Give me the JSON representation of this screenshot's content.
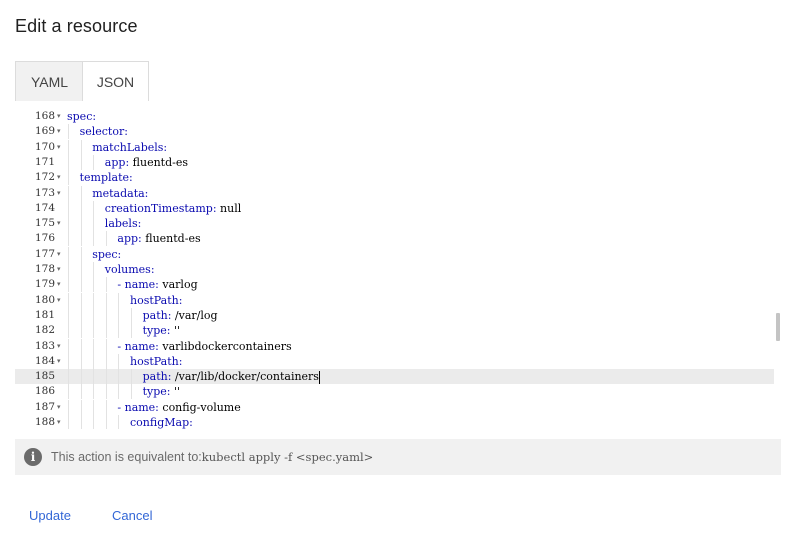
{
  "dialog": {
    "title": "Edit a resource"
  },
  "tabs": [
    {
      "label": "YAML",
      "active": false
    },
    {
      "label": "JSON",
      "active": true
    }
  ],
  "editor": {
    "active_line": "185",
    "lines": [
      {
        "num": "168",
        "fold": true,
        "indent": 0,
        "key": "spec:",
        "value": ""
      },
      {
        "num": "169",
        "fold": true,
        "indent": 1,
        "key": "selector:",
        "value": ""
      },
      {
        "num": "170",
        "fold": true,
        "indent": 2,
        "key": "matchLabels:",
        "value": ""
      },
      {
        "num": "171",
        "fold": false,
        "indent": 3,
        "key": "app:",
        "value": " fluentd-es"
      },
      {
        "num": "172",
        "fold": true,
        "indent": 1,
        "key": "template:",
        "value": ""
      },
      {
        "num": "173",
        "fold": true,
        "indent": 2,
        "key": "metadata:",
        "value": ""
      },
      {
        "num": "174",
        "fold": false,
        "indent": 3,
        "key": "creationTimestamp:",
        "value": " null"
      },
      {
        "num": "175",
        "fold": true,
        "indent": 3,
        "key": "labels:",
        "value": ""
      },
      {
        "num": "176",
        "fold": false,
        "indent": 4,
        "key": "app:",
        "value": " fluentd-es"
      },
      {
        "num": "177",
        "fold": true,
        "indent": 2,
        "key": "spec:",
        "value": ""
      },
      {
        "num": "178",
        "fold": true,
        "indent": 3,
        "key": "volumes:",
        "value": ""
      },
      {
        "num": "179",
        "fold": true,
        "indent": 4,
        "key": "- name:",
        "value": " varlog"
      },
      {
        "num": "180",
        "fold": true,
        "indent": 5,
        "key": "hostPath:",
        "value": ""
      },
      {
        "num": "181",
        "fold": false,
        "indent": 6,
        "key": "path:",
        "value": " /var/log"
      },
      {
        "num": "182",
        "fold": false,
        "indent": 6,
        "key": "type:",
        "value": " ''"
      },
      {
        "num": "183",
        "fold": true,
        "indent": 4,
        "key": "- name:",
        "value": " varlibdockercontainers"
      },
      {
        "num": "184",
        "fold": true,
        "indent": 5,
        "key": "hostPath:",
        "value": ""
      },
      {
        "num": "185",
        "fold": false,
        "indent": 6,
        "key": "path:",
        "value": " /var/lib/docker/containers"
      },
      {
        "num": "186",
        "fold": false,
        "indent": 6,
        "key": "type:",
        "value": " ''"
      },
      {
        "num": "187",
        "fold": true,
        "indent": 4,
        "key": "- name:",
        "value": " config-volume"
      },
      {
        "num": "188",
        "fold": true,
        "indent": 5,
        "key": "configMap:",
        "value": ""
      }
    ]
  },
  "info": {
    "icon": "info-icon",
    "glyph": "i",
    "text": "This action is equivalent to:",
    "command": "kubectl apply -f <spec.yaml>"
  },
  "actions": {
    "update_label": "Update",
    "cancel_label": "Cancel"
  },
  "colors": {
    "accent": "#3367d6",
    "key": "#0b0bb0",
    "active_line": "#ebebeb"
  }
}
